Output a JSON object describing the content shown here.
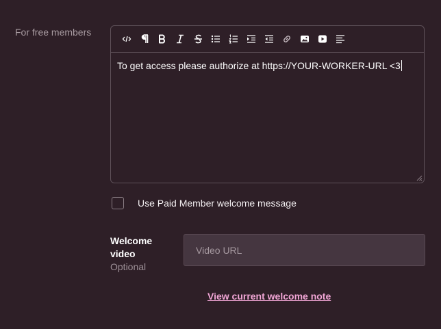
{
  "section": {
    "label": "For free members"
  },
  "editor": {
    "toolbar": [
      {
        "name": "code-icon",
        "title": "Code"
      },
      {
        "name": "paragraph-icon",
        "title": "Paragraph"
      },
      {
        "name": "bold-icon",
        "title": "Bold"
      },
      {
        "name": "italic-icon",
        "title": "Italic"
      },
      {
        "name": "strikethrough-icon",
        "title": "Strikethrough"
      },
      {
        "name": "bullet-list-icon",
        "title": "Bulleted list"
      },
      {
        "name": "numbered-list-icon",
        "title": "Numbered list"
      },
      {
        "name": "indent-icon",
        "title": "Indent"
      },
      {
        "name": "outdent-icon",
        "title": "Outdent"
      },
      {
        "name": "link-icon",
        "title": "Link"
      },
      {
        "name": "image-icon",
        "title": "Image"
      },
      {
        "name": "video-icon",
        "title": "Video"
      },
      {
        "name": "align-icon",
        "title": "Align"
      }
    ],
    "content": "To get access please authorize at https://YOUR-WORKER-URL <3"
  },
  "paid_welcome": {
    "label": "Use Paid Member welcome message",
    "checked": false
  },
  "welcome_video": {
    "title": "Welcome video",
    "optional": "Optional",
    "placeholder": "Video URL",
    "value": ""
  },
  "view_note_link": "View current welcome note",
  "colors": {
    "background": "#2e1f27",
    "border": "#5e5159",
    "input_bg": "#453640",
    "link": "#f2a6d6"
  }
}
